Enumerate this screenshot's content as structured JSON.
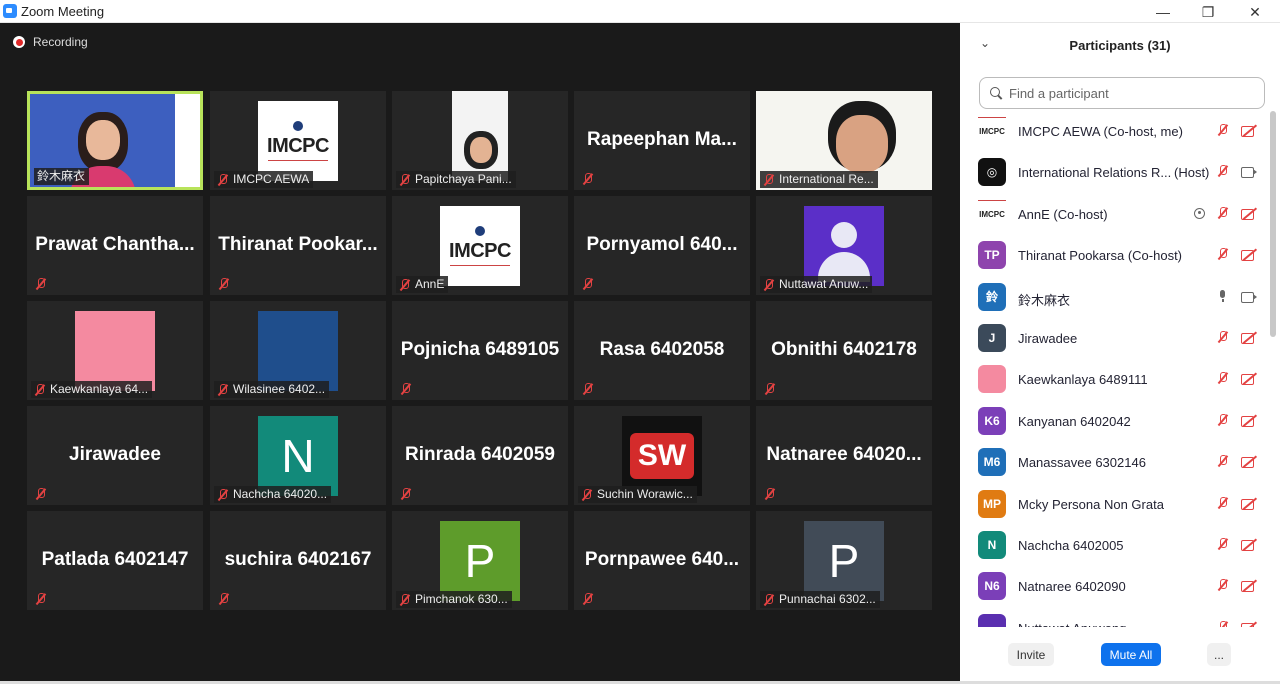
{
  "window": {
    "title": "Zoom Meeting",
    "minimize": "—",
    "restore": "❐",
    "close": "✕"
  },
  "recording": {
    "label": "Recording"
  },
  "tiles": [
    {
      "name": "鈴木麻衣",
      "kind": "photo",
      "muted": false
    },
    {
      "name": "IMCPC AEWA",
      "kind": "logo",
      "muted": true
    },
    {
      "name": "Papitchaya Pani...",
      "kind": "photo",
      "muted": true
    },
    {
      "name": "Rapeephan  Ma...",
      "kind": "big",
      "muted": true
    },
    {
      "name": "International Re...",
      "kind": "photo",
      "muted": true
    },
    {
      "name": "Prawat  Chantha...",
      "kind": "big",
      "muted": true
    },
    {
      "name": "Thiranat  Pookar...",
      "kind": "big",
      "muted": true
    },
    {
      "name": "AnnE",
      "kind": "logo",
      "muted": true
    },
    {
      "name": "Pornyamol  640...",
      "kind": "big",
      "muted": true
    },
    {
      "name": "Nuttawat Anuw...",
      "kind": "avatar",
      "muted": true
    },
    {
      "name": "Kaewkanlaya 64...",
      "kind": "pink",
      "muted": true
    },
    {
      "name": "Wilasinee 6402...",
      "kind": "blue",
      "muted": true
    },
    {
      "name": "Pojnicha 6489105",
      "kind": "big",
      "muted": true
    },
    {
      "name": "Rasa 6402058",
      "kind": "big",
      "muted": true
    },
    {
      "name": "Obnithi 6402178",
      "kind": "big",
      "muted": true
    },
    {
      "name": "Jirawadee",
      "kind": "big",
      "muted": true
    },
    {
      "name": "Nachcha 64020...",
      "kind": "letter",
      "letter": "N",
      "color": "#128a7a",
      "muted": true
    },
    {
      "name": "Rinrada 6402059",
      "kind": "big",
      "muted": true
    },
    {
      "name": "Suchin Worawic...",
      "kind": "sw",
      "muted": true
    },
    {
      "name": "Natnaree  64020...",
      "kind": "big",
      "muted": true
    },
    {
      "name": "Patlada 6402147",
      "kind": "big",
      "muted": true
    },
    {
      "name": "suchira 6402167",
      "kind": "big",
      "muted": true
    },
    {
      "name": "Pimchanok 630...",
      "kind": "letter",
      "letter": "P",
      "color": "#5e9c2b",
      "muted": true
    },
    {
      "name": "Pornpawee  640...",
      "kind": "big",
      "muted": true
    },
    {
      "name": "Punnachai 6302...",
      "kind": "letter",
      "letter": "P",
      "color": "#414b57",
      "muted": true
    }
  ],
  "logo_text": "IMCPC",
  "sw_text": "SW",
  "panel": {
    "title": "Participants (31)",
    "search_placeholder": "Find a participant",
    "participants": [
      {
        "name": "IMCPC AEWA (Co-host, me)",
        "avatar": "IMCPC",
        "avatar_kind": "logo",
        "mic": "muted",
        "video": "off"
      },
      {
        "name": "International Relations R...",
        "role": "(Host)",
        "avatar": "◎",
        "avatar_color": "#111111",
        "mic": "muted",
        "video": "on"
      },
      {
        "name": "AnnE (Co-host)",
        "avatar": "IMCPC",
        "avatar_kind": "logo",
        "mic": "muted",
        "video": "off",
        "recording": true
      },
      {
        "name": "Thiranat Pookarsa (Co-host)",
        "avatar": "TP",
        "avatar_color": "#8e44ad",
        "mic": "muted",
        "video": "off"
      },
      {
        "name": "鈴木麻衣",
        "avatar": "鈴",
        "avatar_color": "#1f6fb8",
        "mic": "on",
        "video": "on"
      },
      {
        "name": "Jirawadee",
        "avatar": "J",
        "avatar_color": "#3b4a5a",
        "mic": "muted",
        "video": "off"
      },
      {
        "name": "Kaewkanlaya 6489111",
        "avatar": "",
        "avatar_color": "#f48aa0",
        "mic": "muted",
        "video": "off"
      },
      {
        "name": "Kanyanan 6402042",
        "avatar": "K6",
        "avatar_color": "#7b3fb8",
        "mic": "muted",
        "video": "off"
      },
      {
        "name": "Manassavee 6302146",
        "avatar": "M6",
        "avatar_color": "#1f6fb8",
        "mic": "muted",
        "video": "off"
      },
      {
        "name": "Mcky Persona Non Grata",
        "avatar": "MP",
        "avatar_color": "#e07b12",
        "mic": "muted",
        "video": "off"
      },
      {
        "name": "Nachcha 6402005",
        "avatar": "N",
        "avatar_color": "#128a7a",
        "mic": "muted",
        "video": "off"
      },
      {
        "name": "Natnaree 6402090",
        "avatar": "N6",
        "avatar_color": "#7b3fb8",
        "mic": "muted",
        "video": "off"
      },
      {
        "name": "Nuttawat Anuwong...",
        "avatar": "",
        "avatar_color": "#5a2fb0",
        "mic": "muted",
        "video": "off"
      }
    ],
    "footer": {
      "invite": "Invite",
      "mute_all": "Mute All",
      "more": "..."
    }
  }
}
